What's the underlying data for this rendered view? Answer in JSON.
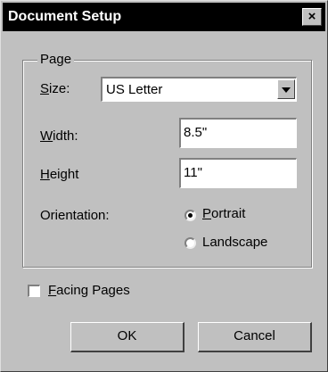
{
  "window": {
    "title": "Document Setup",
    "close_label": "×"
  },
  "page_group": {
    "label": "Page",
    "size": {
      "label_first": "S",
      "label_rest": "ize:",
      "value": "US Letter"
    },
    "width": {
      "label_first": "W",
      "label_rest": "idth:",
      "value": "8.5\""
    },
    "height": {
      "label_first": "H",
      "label_rest": "eight",
      "value": "11\""
    },
    "orientation": {
      "label": "Orientation:",
      "options": [
        {
          "first": "P",
          "rest": "ortrait",
          "checked": true
        },
        {
          "first": "",
          "rest": "Landscape",
          "ul_index": 1,
          "checked": false
        }
      ]
    }
  },
  "facing_pages": {
    "label_first": "F",
    "label_rest": "acing Pages",
    "checked": false
  },
  "buttons": {
    "ok": "OK",
    "cancel": "Cancel"
  }
}
